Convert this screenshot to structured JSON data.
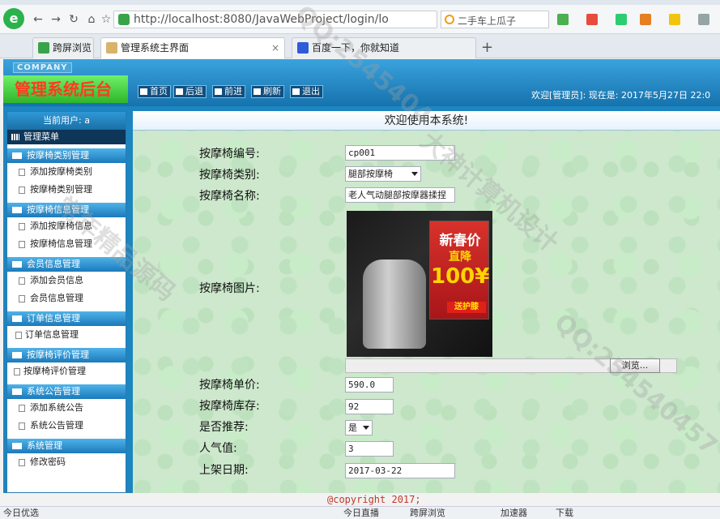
{
  "browser": {
    "url": "http://localhost:8080/JavaWebProject/login/lo",
    "search_text": "二手车上瓜子",
    "tabs": [
      {
        "label": "跨屏浏览"
      },
      {
        "label": "管理系统主界面"
      },
      {
        "label": "百度一下，你就知道"
      }
    ],
    "new_tab": "+"
  },
  "app": {
    "company": "COMPANY",
    "title": "管理系统后台",
    "nav": [
      {
        "label": "首页"
      },
      {
        "label": "后退"
      },
      {
        "label": "前进"
      },
      {
        "label": "刷新"
      },
      {
        "label": "退出"
      }
    ],
    "welcome": "欢迎[管理员]:  现在是: 2017年5月27日 22:0"
  },
  "sidebar": {
    "current_user": "当前用户: a",
    "menu_head": "管理菜单",
    "groups": [
      {
        "title": "按摩椅类别管理",
        "items": [
          "添加按摩椅类别",
          "按摩椅类别管理"
        ]
      },
      {
        "title": "按摩椅信息管理",
        "items": [
          "添加按摩椅信息",
          "按摩椅信息管理"
        ]
      },
      {
        "title": "会员信息管理",
        "items": [
          "添加会员信息",
          "会员信息管理"
        ]
      },
      {
        "title": "订单信息管理",
        "items": [
          "订单信息管理"
        ]
      },
      {
        "title": "按摩椅评价管理",
        "items": [
          "按摩椅评价管理"
        ]
      },
      {
        "title": "系统公告管理",
        "items": [
          "添加系统公告",
          "系统公告管理"
        ]
      },
      {
        "title": "系统管理",
        "items": [
          "修改密码"
        ]
      }
    ]
  },
  "content": {
    "title": "欢迎使用本系统!",
    "fields": {
      "code_label": "按摩椅编号:",
      "code_value": "cp001",
      "type_label": "按摩椅类别:",
      "type_value": "腿部按摩椅",
      "name_label": "按摩椅名称:",
      "name_value": "老人气动腿部按摩器揉捏",
      "image_label": "按摩椅图片:",
      "image_promo_1": "新春价",
      "image_promo_2": "直降",
      "image_promo_3": "100¥",
      "image_gift": "送护膝",
      "browse": "浏览...",
      "price_label": "按摩椅单价:",
      "price_value": "590.0",
      "stock_label": "按摩椅库存:",
      "stock_value": "92",
      "recommend_label": "是否推荐:",
      "recommend_value": "是",
      "popularity_label": "人气值:",
      "popularity_value": "3",
      "date_label": "上架日期:",
      "date_value": "2017-03-22"
    },
    "copyright": "@copyright 2017;"
  },
  "statusbar": {
    "left": "今日优选",
    "items": [
      "今日直播",
      "跨屏浏览",
      "加速器",
      "下载"
    ]
  },
  "watermarks": [
    "QQ:2545404",
    "大神计算机设计",
    "常年精品源码",
    "QQ:254540457"
  ]
}
